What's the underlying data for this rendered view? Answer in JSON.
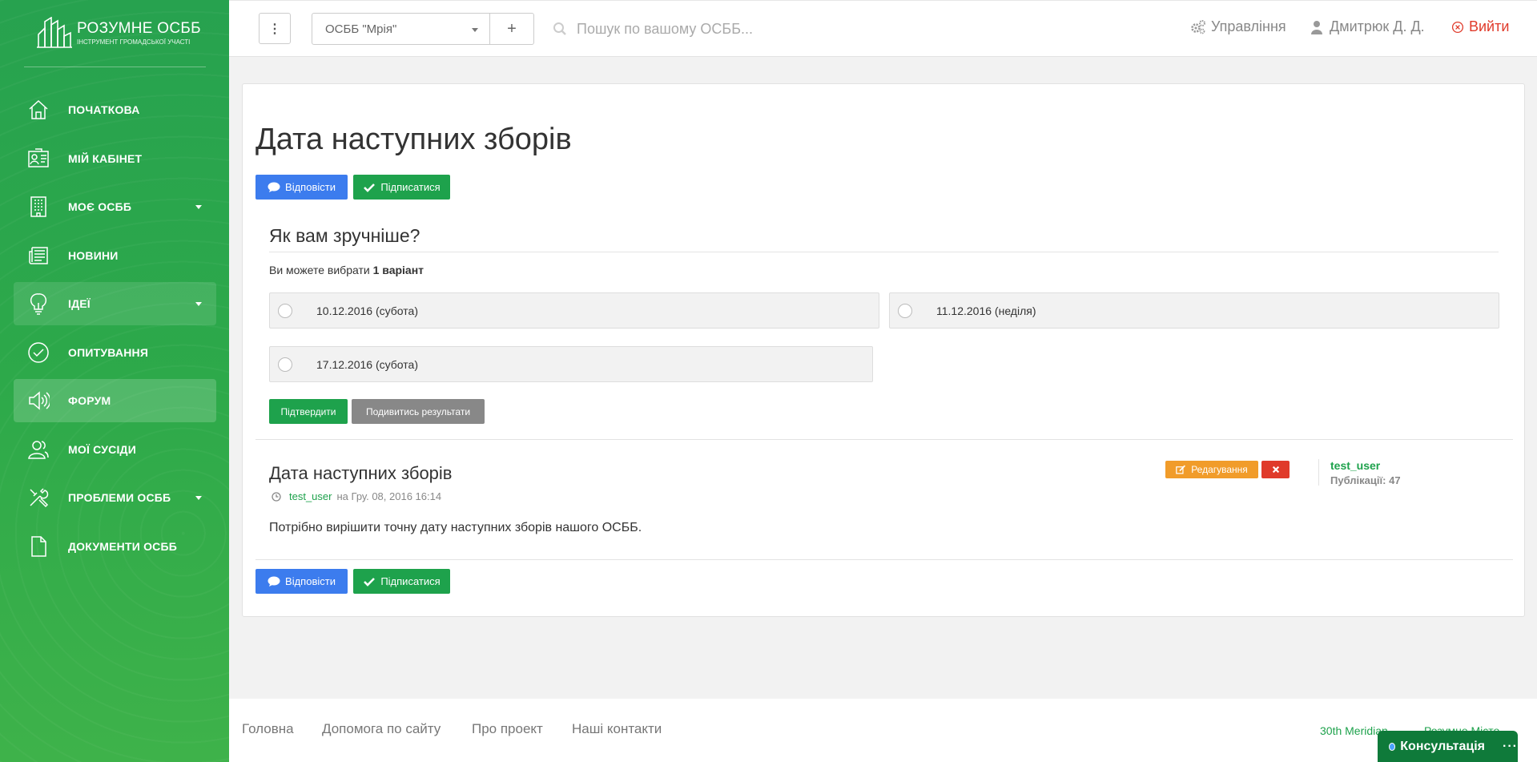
{
  "brand": {
    "title": "РОЗУМНЕ ОСББ",
    "subtitle": "ІНСТРУМЕНТ ГРОМАДСЬКОЇ УЧАСТІ"
  },
  "sidebar": {
    "items": [
      {
        "label": "ПОЧАТКОВА",
        "icon": "home-icon"
      },
      {
        "label": "МІЙ КАБІНЕТ",
        "icon": "id-card-icon"
      },
      {
        "label": "МОЄ ОСББ",
        "icon": "building-icon",
        "has_submenu": true
      },
      {
        "label": "НОВИНИ",
        "icon": "newspaper-icon"
      },
      {
        "label": "ІДЕЇ",
        "icon": "lightbulb-icon",
        "has_submenu": true
      },
      {
        "label": "ОПИТУВАННЯ",
        "icon": "check-circle-icon"
      },
      {
        "label": "ФОРУМ",
        "icon": "megaphone-icon",
        "active": true
      },
      {
        "label": "МОЇ СУСІДИ",
        "icon": "users-icon"
      },
      {
        "label": "ПРОБЛЕМИ ОСББ",
        "icon": "tools-icon",
        "has_submenu": true
      },
      {
        "label": "ДОКУМЕНТИ ОСББ",
        "icon": "document-icon"
      }
    ]
  },
  "topbar": {
    "dots_label": "⋮",
    "osbb_selected": "ОСББ \"Мрія\"",
    "plus_label": "+",
    "search_placeholder": "Пошук по вашому ОСББ...",
    "manage_label": "Управління",
    "user_name": "Дмитрюк Д. Д.",
    "logout_label": "Вийти"
  },
  "topic": {
    "title": "Дата наступних зборів",
    "reply_label": "Відповісти",
    "subscribe_label": "Підписатися"
  },
  "poll": {
    "question": "Як вам зручніше?",
    "hint_prefix": "Ви можете вибрати",
    "hint_bold": "1 варіант",
    "options": [
      "10.12.2016 (субота)",
      "11.12.2016 (неділя)",
      "17.12.2016 (субота)"
    ],
    "confirm_label": "Підтвердити",
    "results_label": "Подивитись результати"
  },
  "post": {
    "title": "Дата наступних зборів",
    "author": "test_user",
    "date_text": "на Гру. 08, 2016 16:14",
    "body": "Потрібно вирішити точну дату наступних зборів нашого ОСББ.",
    "edit_label": "Редагування",
    "side_user": "test_user",
    "side_pubs": "Публікації: 47"
  },
  "footer": {
    "links": [
      "Головна",
      "Допомога по сайту",
      "Про проект",
      "Наші контакти"
    ],
    "right_links": [
      "30th Meridian",
      "Розумне Місто"
    ],
    "consult_label": "Консультація",
    "consult_more": "···"
  },
  "colors": {
    "green": "#1ea24c",
    "blue": "#3c7cee",
    "orange": "#f19c2a",
    "red": "#e03a2a"
  }
}
